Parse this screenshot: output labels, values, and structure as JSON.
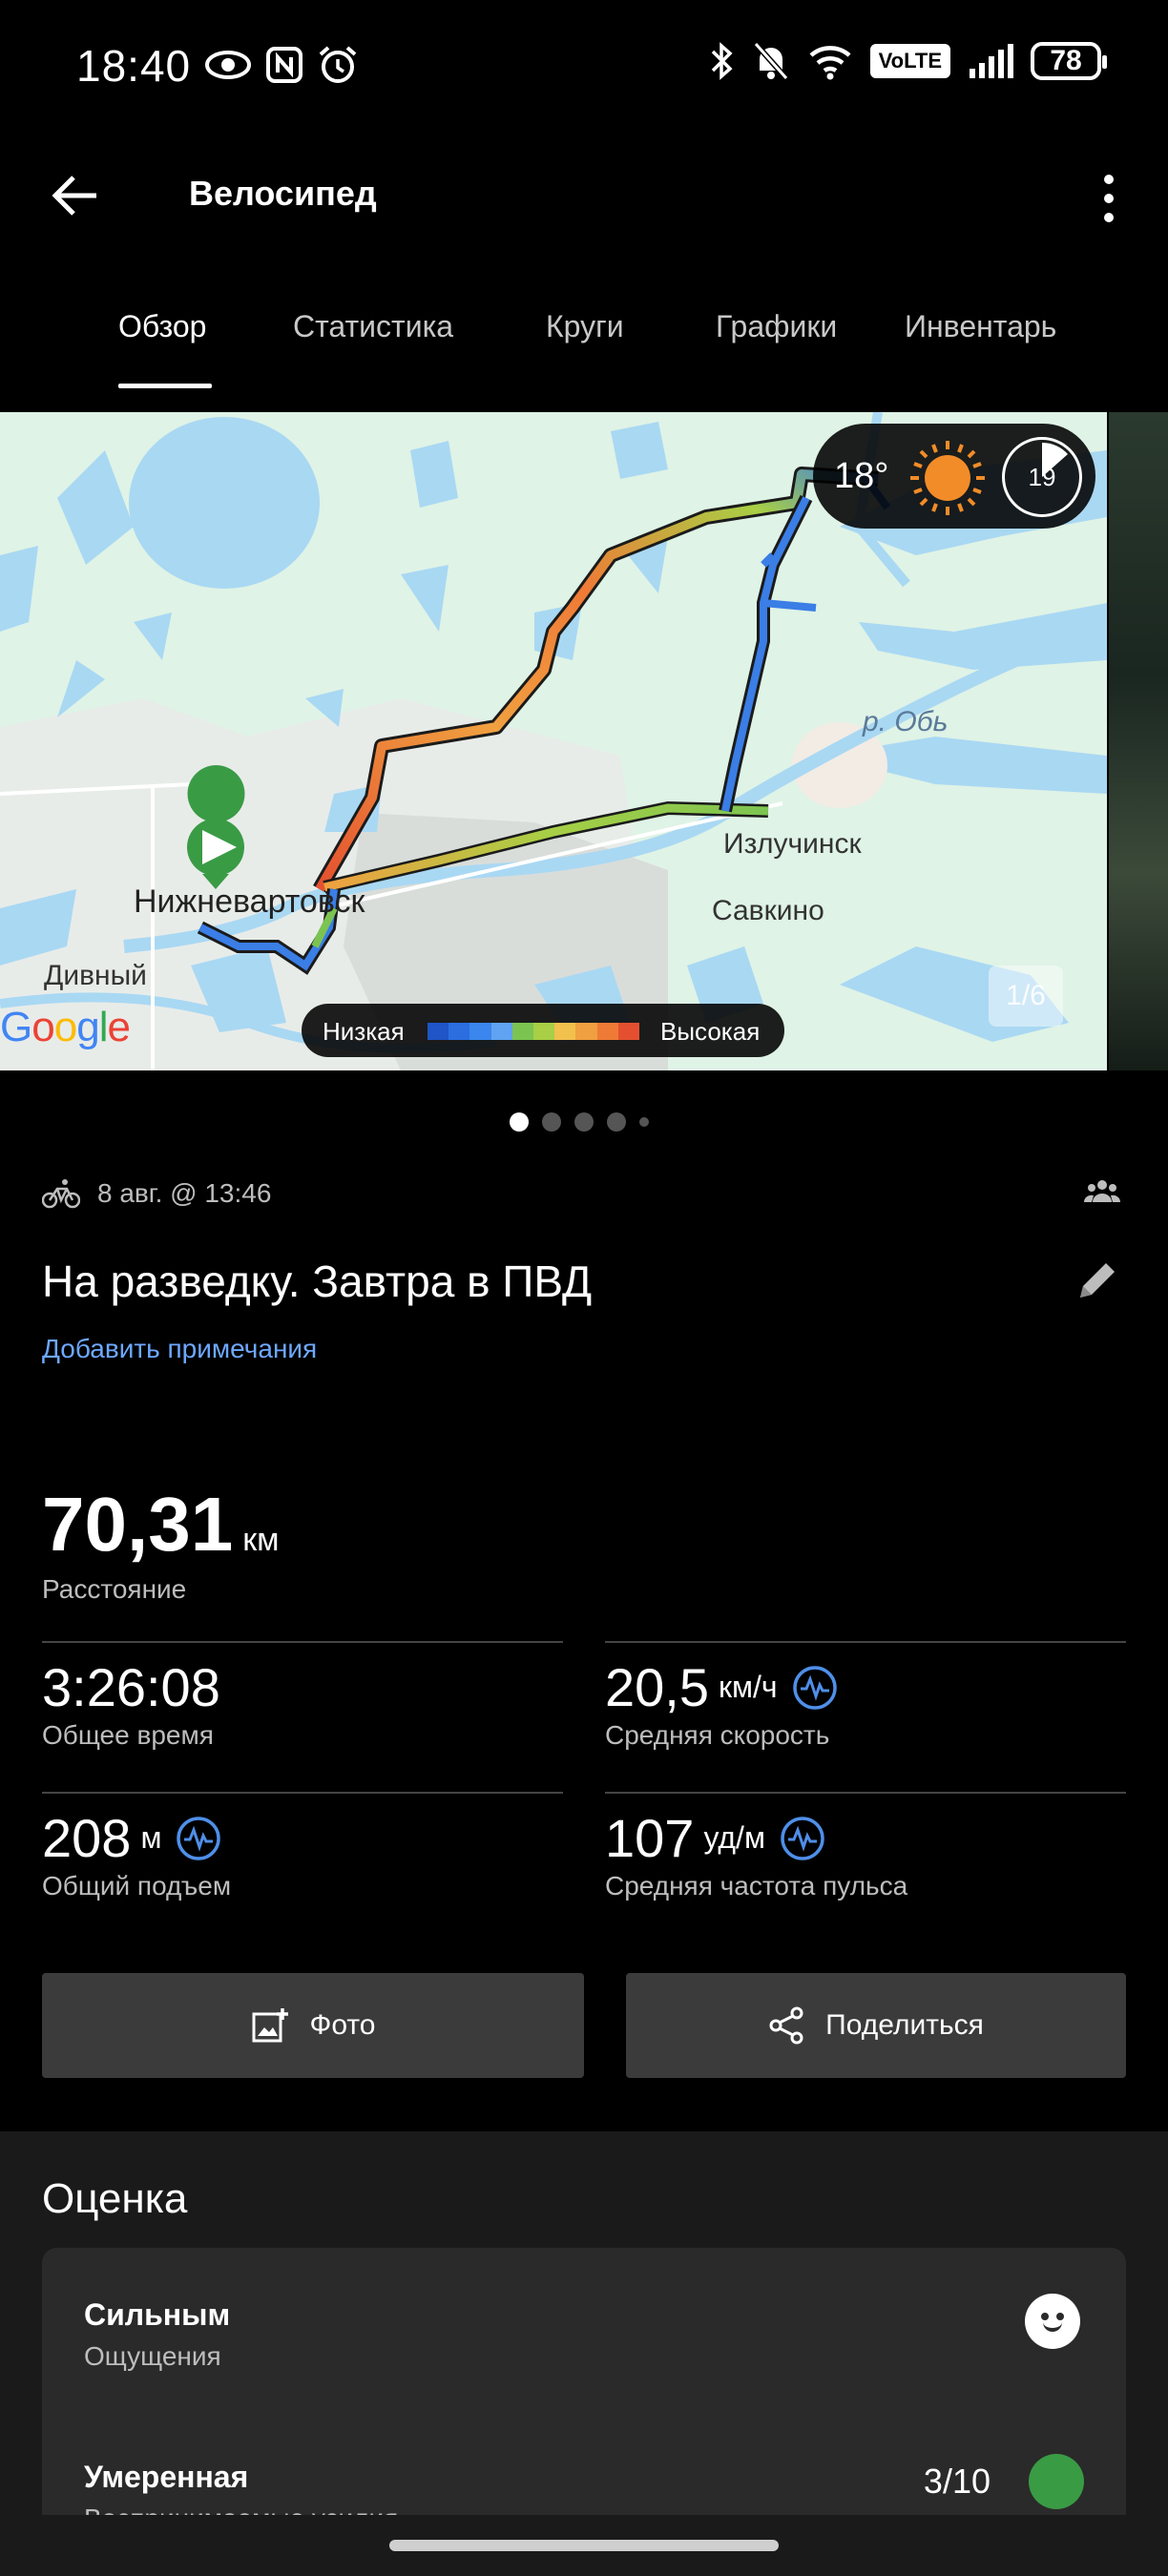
{
  "status_bar": {
    "time": "18:40",
    "battery": "78",
    "network_badge": "VoLTE",
    "icons": [
      "eye-icon",
      "nfc-icon",
      "alarm-icon",
      "bluetooth-icon",
      "mute-icon",
      "wifi-icon",
      "signal-icon",
      "battery-icon"
    ]
  },
  "app_bar": {
    "title": "Велосипед"
  },
  "tabs": [
    {
      "label": "Обзор",
      "active": true
    },
    {
      "label": "Статистика",
      "active": false
    },
    {
      "label": "Круги",
      "active": false
    },
    {
      "label": "Графики",
      "active": false
    },
    {
      "label": "Инвентарь",
      "active": false
    }
  ],
  "map": {
    "weather_temp": "18°",
    "weather_clock": "19",
    "legend_low": "Низкая",
    "legend_high": "Высокая",
    "legend_colors": [
      "#1f55c7",
      "#2a6ee0",
      "#3b86ee",
      "#5fa3f2",
      "#7cc451",
      "#a8cf45",
      "#f1c04d",
      "#f0a040",
      "#ef7a36",
      "#e4502f"
    ],
    "labels": {
      "city": "Нижневартовск",
      "town1": "Излучинск",
      "town2": "Савкино",
      "town3": "Дивный",
      "river": "р. Обь"
    },
    "google_letters": [
      {
        "ch": "G",
        "color": "#4285f4"
      },
      {
        "ch": "o",
        "color": "#ea4335"
      },
      {
        "ch": "o",
        "color": "#fbbc05"
      },
      {
        "ch": "g",
        "color": "#4285f4"
      },
      {
        "ch": "l",
        "color": "#34a853"
      },
      {
        "ch": "e",
        "color": "#ea4335"
      }
    ],
    "photo_counter": "1/6"
  },
  "pager": {
    "current": 1,
    "total": 5
  },
  "activity": {
    "date": "8 авг. @ 13:46",
    "title": "На разведку. Завтра в ПВД",
    "add_notes": "Добавить примечания"
  },
  "stats": {
    "distance": {
      "value": "70,31",
      "unit": "км",
      "label": "Расстояние"
    },
    "total_time": {
      "value": "3:26:08",
      "unit": "",
      "label": "Общее время"
    },
    "avg_speed": {
      "value": "20,5",
      "unit": "км/ч",
      "label": "Средняя скорость"
    },
    "elevation": {
      "value": "208",
      "unit": "м",
      "label": "Общий подъем"
    },
    "avg_hr": {
      "value": "107",
      "unit": "уд/м",
      "label": "Средняя частота пульса"
    }
  },
  "actions": {
    "photo": "Фото",
    "share": "Поделиться"
  },
  "rating": {
    "title": "Оценка",
    "feeling_value": "Сильным",
    "feeling_label": "Ощущения",
    "effort_value": "Умеренная",
    "effort_label": "Воспринимаемые усилия",
    "effort_score": "3/10",
    "accent_green": "#3a9b45"
  },
  "colors": {
    "background": "#000000",
    "link_blue": "#6ea8ff",
    "button_bg": "#3b3b3b",
    "card_bg": "#2a2a2a"
  }
}
